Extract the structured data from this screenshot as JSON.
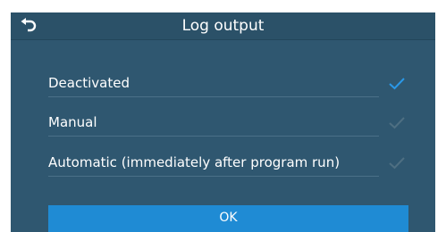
{
  "header": {
    "title": "Log output",
    "back_icon": "back-arrow-icon"
  },
  "options": [
    {
      "label": "Deactivated",
      "selected": true,
      "check_color": "#2a98e8"
    },
    {
      "label": "Manual",
      "selected": false,
      "check_color": "#4e6f82"
    },
    {
      "label": "Automatic (immediately after program run)",
      "selected": false,
      "check_color": "#4e6f82"
    }
  ],
  "ok_button": {
    "label": "OK"
  },
  "colors": {
    "background": "#2f5770",
    "header": "#2b5168",
    "accent": "#1f8bd4"
  }
}
